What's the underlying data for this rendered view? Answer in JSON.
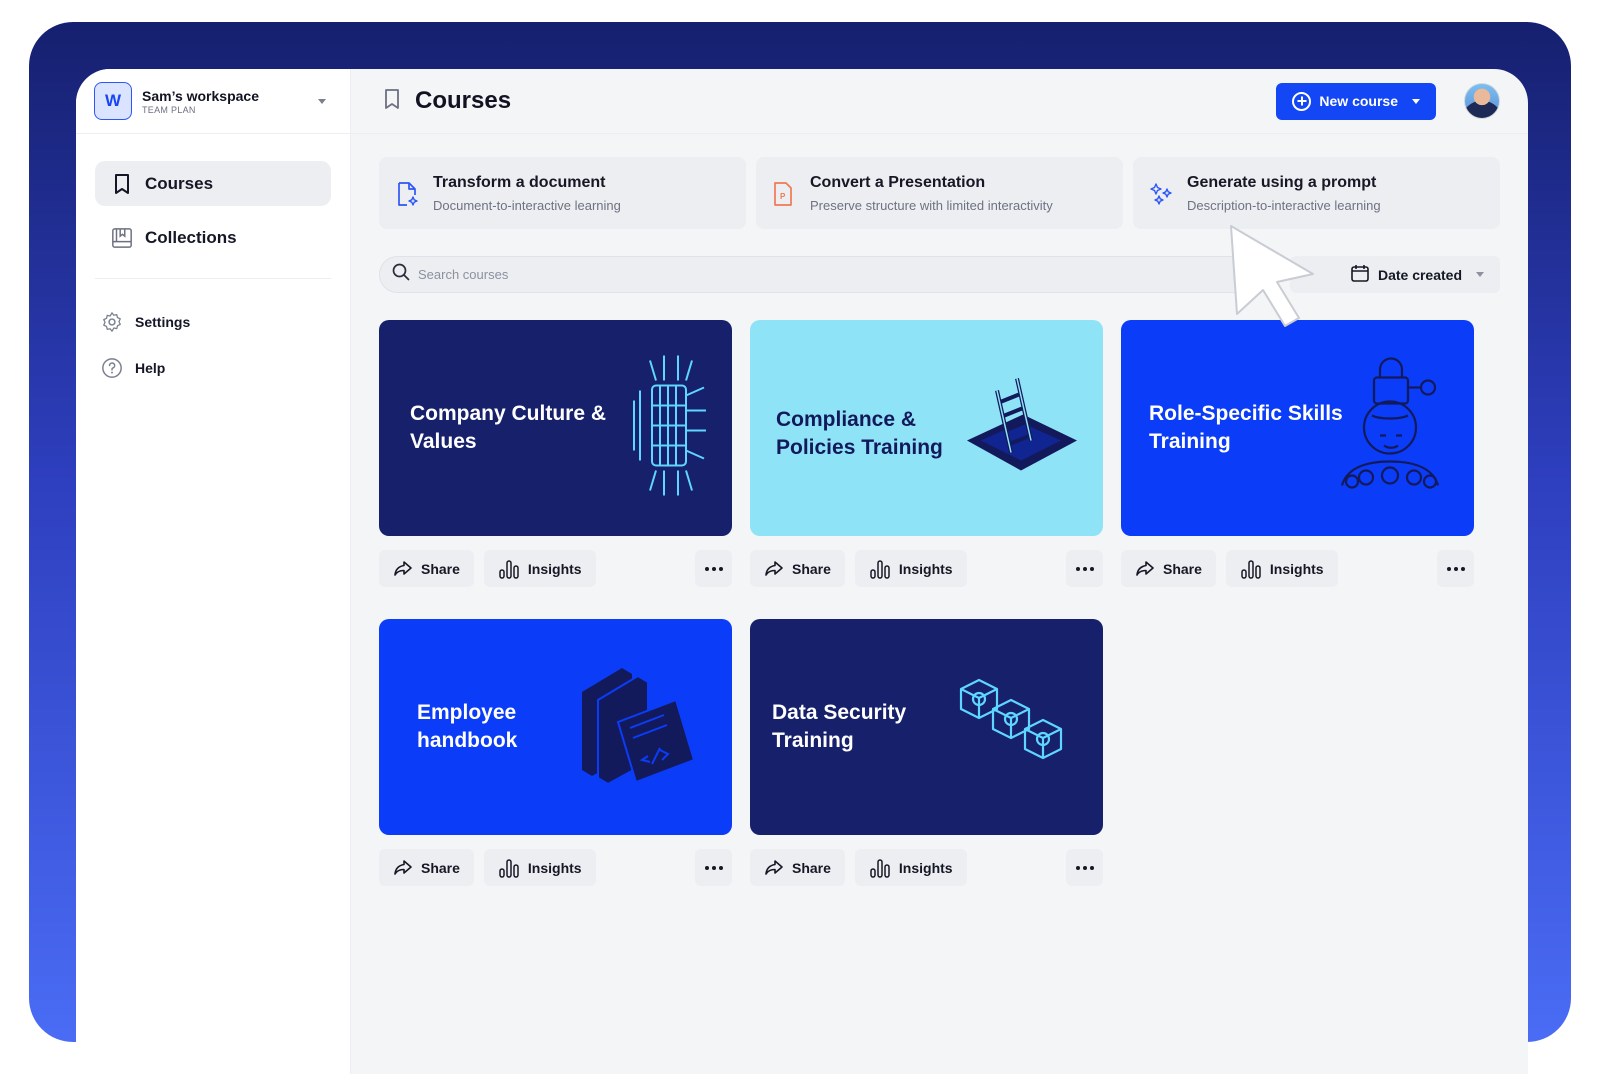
{
  "workspace": {
    "badge": "W",
    "name": "Sam’s workspace",
    "plan": "TEAM PLAN"
  },
  "sidebar": {
    "primary": [
      {
        "label": "Courses",
        "icon": "bookmark-icon",
        "active": true
      },
      {
        "label": "Collections",
        "icon": "book-icon",
        "active": false
      }
    ],
    "secondary": [
      {
        "label": "Settings",
        "icon": "gear-icon"
      },
      {
        "label": "Help",
        "icon": "help-circle-icon"
      }
    ]
  },
  "header": {
    "title": "Courses",
    "new_button": "New course"
  },
  "actions": [
    {
      "title": "Transform a document",
      "desc": "Document-to-interactive learning",
      "icon": "document-sparkle-icon"
    },
    {
      "title": "Convert a Presentation",
      "desc": "Preserve structure with limited interactivity",
      "icon": "presentation-file-icon"
    },
    {
      "title": "Generate using a prompt",
      "desc": "Description-to-interactive learning",
      "icon": "sparkles-icon"
    }
  ],
  "search": {
    "placeholder": "Search courses"
  },
  "sort": {
    "label": "Date created"
  },
  "card_labels": {
    "share": "Share",
    "insights": "Insights"
  },
  "courses": [
    {
      "title": "Company Culture & Values",
      "bg": "#17206b",
      "art": "piano-icon"
    },
    {
      "title": "Compliance & Policies Training",
      "bg": "#8fe3f6",
      "art": "ladder-icon"
    },
    {
      "title": "Role-Specific Skills Training",
      "bg": "#0b3cf7",
      "art": "head-lock-icon"
    },
    {
      "title": "Employee handbook",
      "bg": "#0b3cf7",
      "art": "books-icon"
    },
    {
      "title": "Data Security Training",
      "bg": "#17206b",
      "art": "cubes-icon"
    }
  ],
  "colors": {
    "accent": "#1346f5",
    "frame_top": "#16206f",
    "frame_bottom": "#4a6cf5"
  }
}
